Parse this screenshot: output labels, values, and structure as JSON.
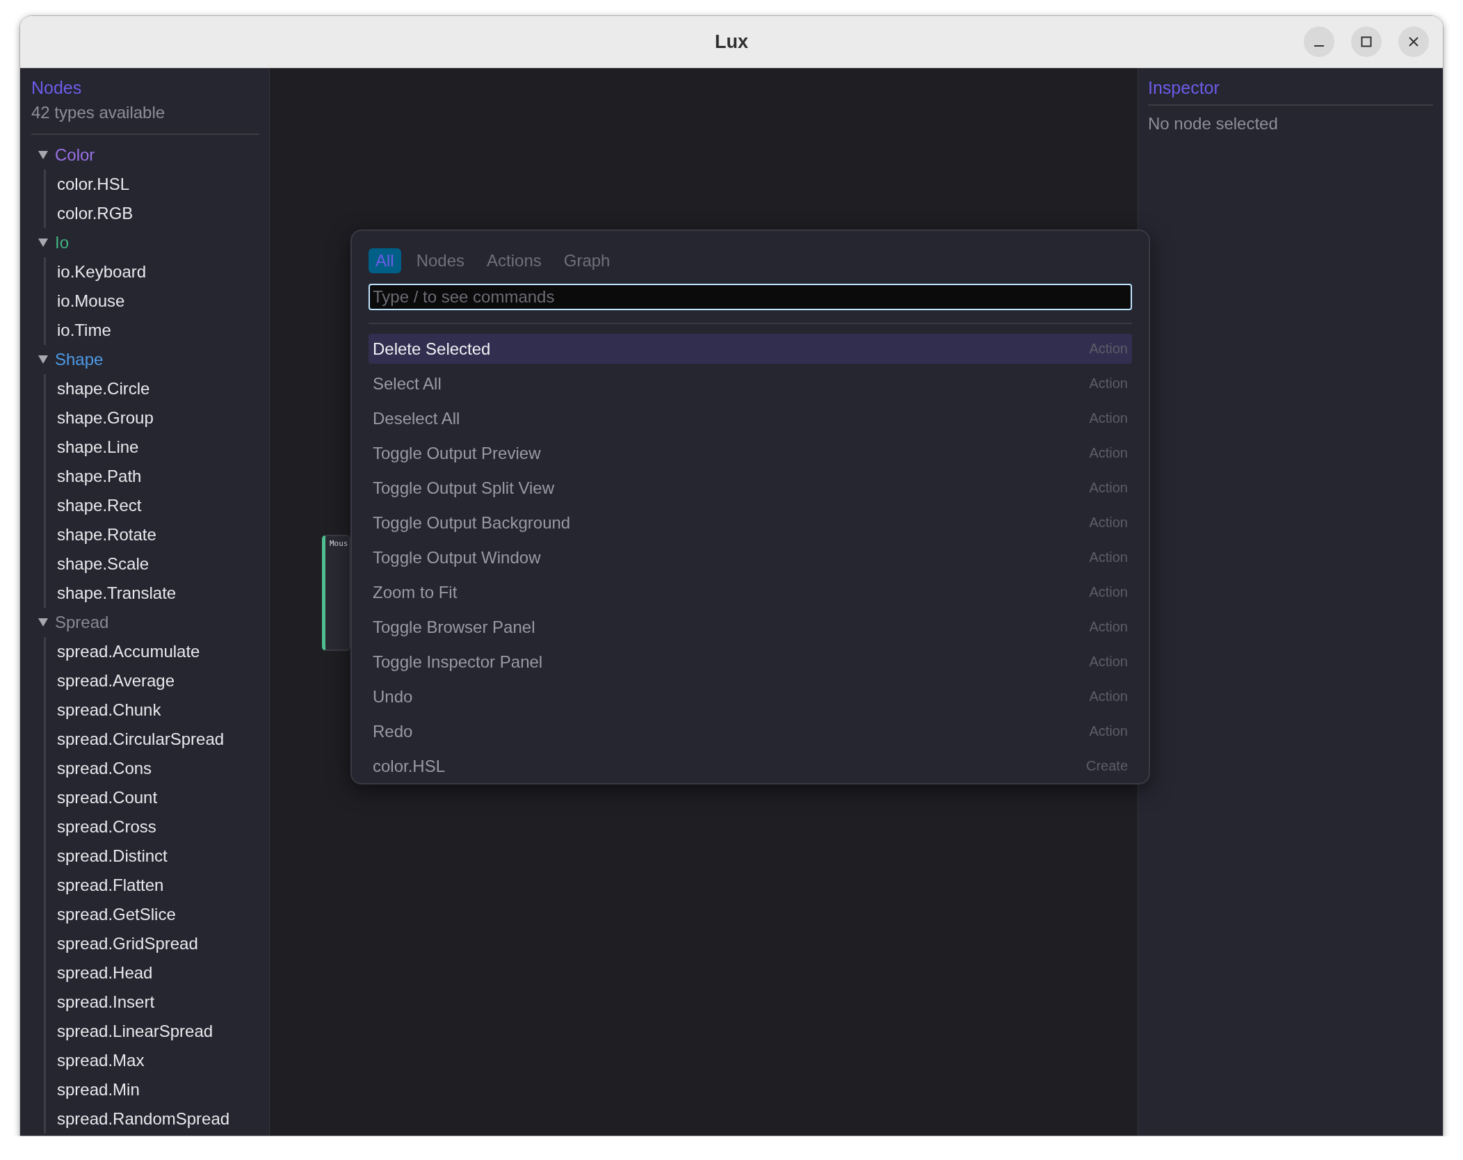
{
  "window": {
    "title": "Lux"
  },
  "browser": {
    "title": "Nodes",
    "subtitle": "42 types available",
    "categories": [
      {
        "label": "Color",
        "color": "#9a72e6",
        "expanded": true,
        "children": [
          {
            "label": "color.HSL"
          },
          {
            "label": "color.RGB"
          }
        ]
      },
      {
        "label": "Io",
        "color": "#3fb37f",
        "expanded": true,
        "children": [
          {
            "label": "io.Keyboard"
          },
          {
            "label": "io.Mouse"
          },
          {
            "label": "io.Time"
          }
        ]
      },
      {
        "label": "Shape",
        "color": "#4d9be6",
        "expanded": true,
        "children": [
          {
            "label": "shape.Circle"
          },
          {
            "label": "shape.Group"
          },
          {
            "label": "shape.Line"
          },
          {
            "label": "shape.Path"
          },
          {
            "label": "shape.Rect"
          },
          {
            "label": "shape.Rotate"
          },
          {
            "label": "shape.Scale"
          },
          {
            "label": "shape.Translate"
          }
        ]
      },
      {
        "label": "Spread",
        "color": "#8a8a96",
        "expanded": true,
        "children": [
          {
            "label": "spread.Accumulate"
          },
          {
            "label": "spread.Average"
          },
          {
            "label": "spread.Chunk"
          },
          {
            "label": "spread.CircularSpread"
          },
          {
            "label": "spread.Cons"
          },
          {
            "label": "spread.Count"
          },
          {
            "label": "spread.Cross"
          },
          {
            "label": "spread.Distinct"
          },
          {
            "label": "spread.Flatten"
          },
          {
            "label": "spread.GetSlice"
          },
          {
            "label": "spread.GridSpread"
          },
          {
            "label": "spread.Head"
          },
          {
            "label": "spread.Insert"
          },
          {
            "label": "spread.LinearSpread"
          },
          {
            "label": "spread.Max"
          },
          {
            "label": "spread.Min"
          },
          {
            "label": "spread.RandomSpread"
          }
        ]
      }
    ]
  },
  "canvas": {
    "nodes": [
      {
        "title": "Mous"
      }
    ]
  },
  "palette": {
    "tabs": [
      {
        "label": "All",
        "selected": true
      },
      {
        "label": "Nodes",
        "selected": false
      },
      {
        "label": "Actions",
        "selected": false
      },
      {
        "label": "Graph",
        "selected": false
      }
    ],
    "search": {
      "placeholder": "Type / to see commands"
    },
    "commands": [
      {
        "label": "Delete Selected",
        "kind": "Action",
        "selected": true
      },
      {
        "label": "Select All",
        "kind": "Action",
        "selected": false
      },
      {
        "label": "Deselect All",
        "kind": "Action",
        "selected": false
      },
      {
        "label": "Toggle Output Preview",
        "kind": "Action",
        "selected": false
      },
      {
        "label": "Toggle Output Split View",
        "kind": "Action",
        "selected": false
      },
      {
        "label": "Toggle Output Background",
        "kind": "Action",
        "selected": false
      },
      {
        "label": "Toggle Output Window",
        "kind": "Action",
        "selected": false
      },
      {
        "label": "Zoom to Fit",
        "kind": "Action",
        "selected": false
      },
      {
        "label": "Toggle Browser Panel",
        "kind": "Action",
        "selected": false
      },
      {
        "label": "Toggle Inspector Panel",
        "kind": "Action",
        "selected": false
      },
      {
        "label": "Undo",
        "kind": "Action",
        "selected": false
      },
      {
        "label": "Redo",
        "kind": "Action",
        "selected": false
      },
      {
        "label": "color.HSL",
        "kind": "Create",
        "selected": false
      }
    ]
  },
  "inspector": {
    "title": "Inspector",
    "message": "No node selected"
  }
}
